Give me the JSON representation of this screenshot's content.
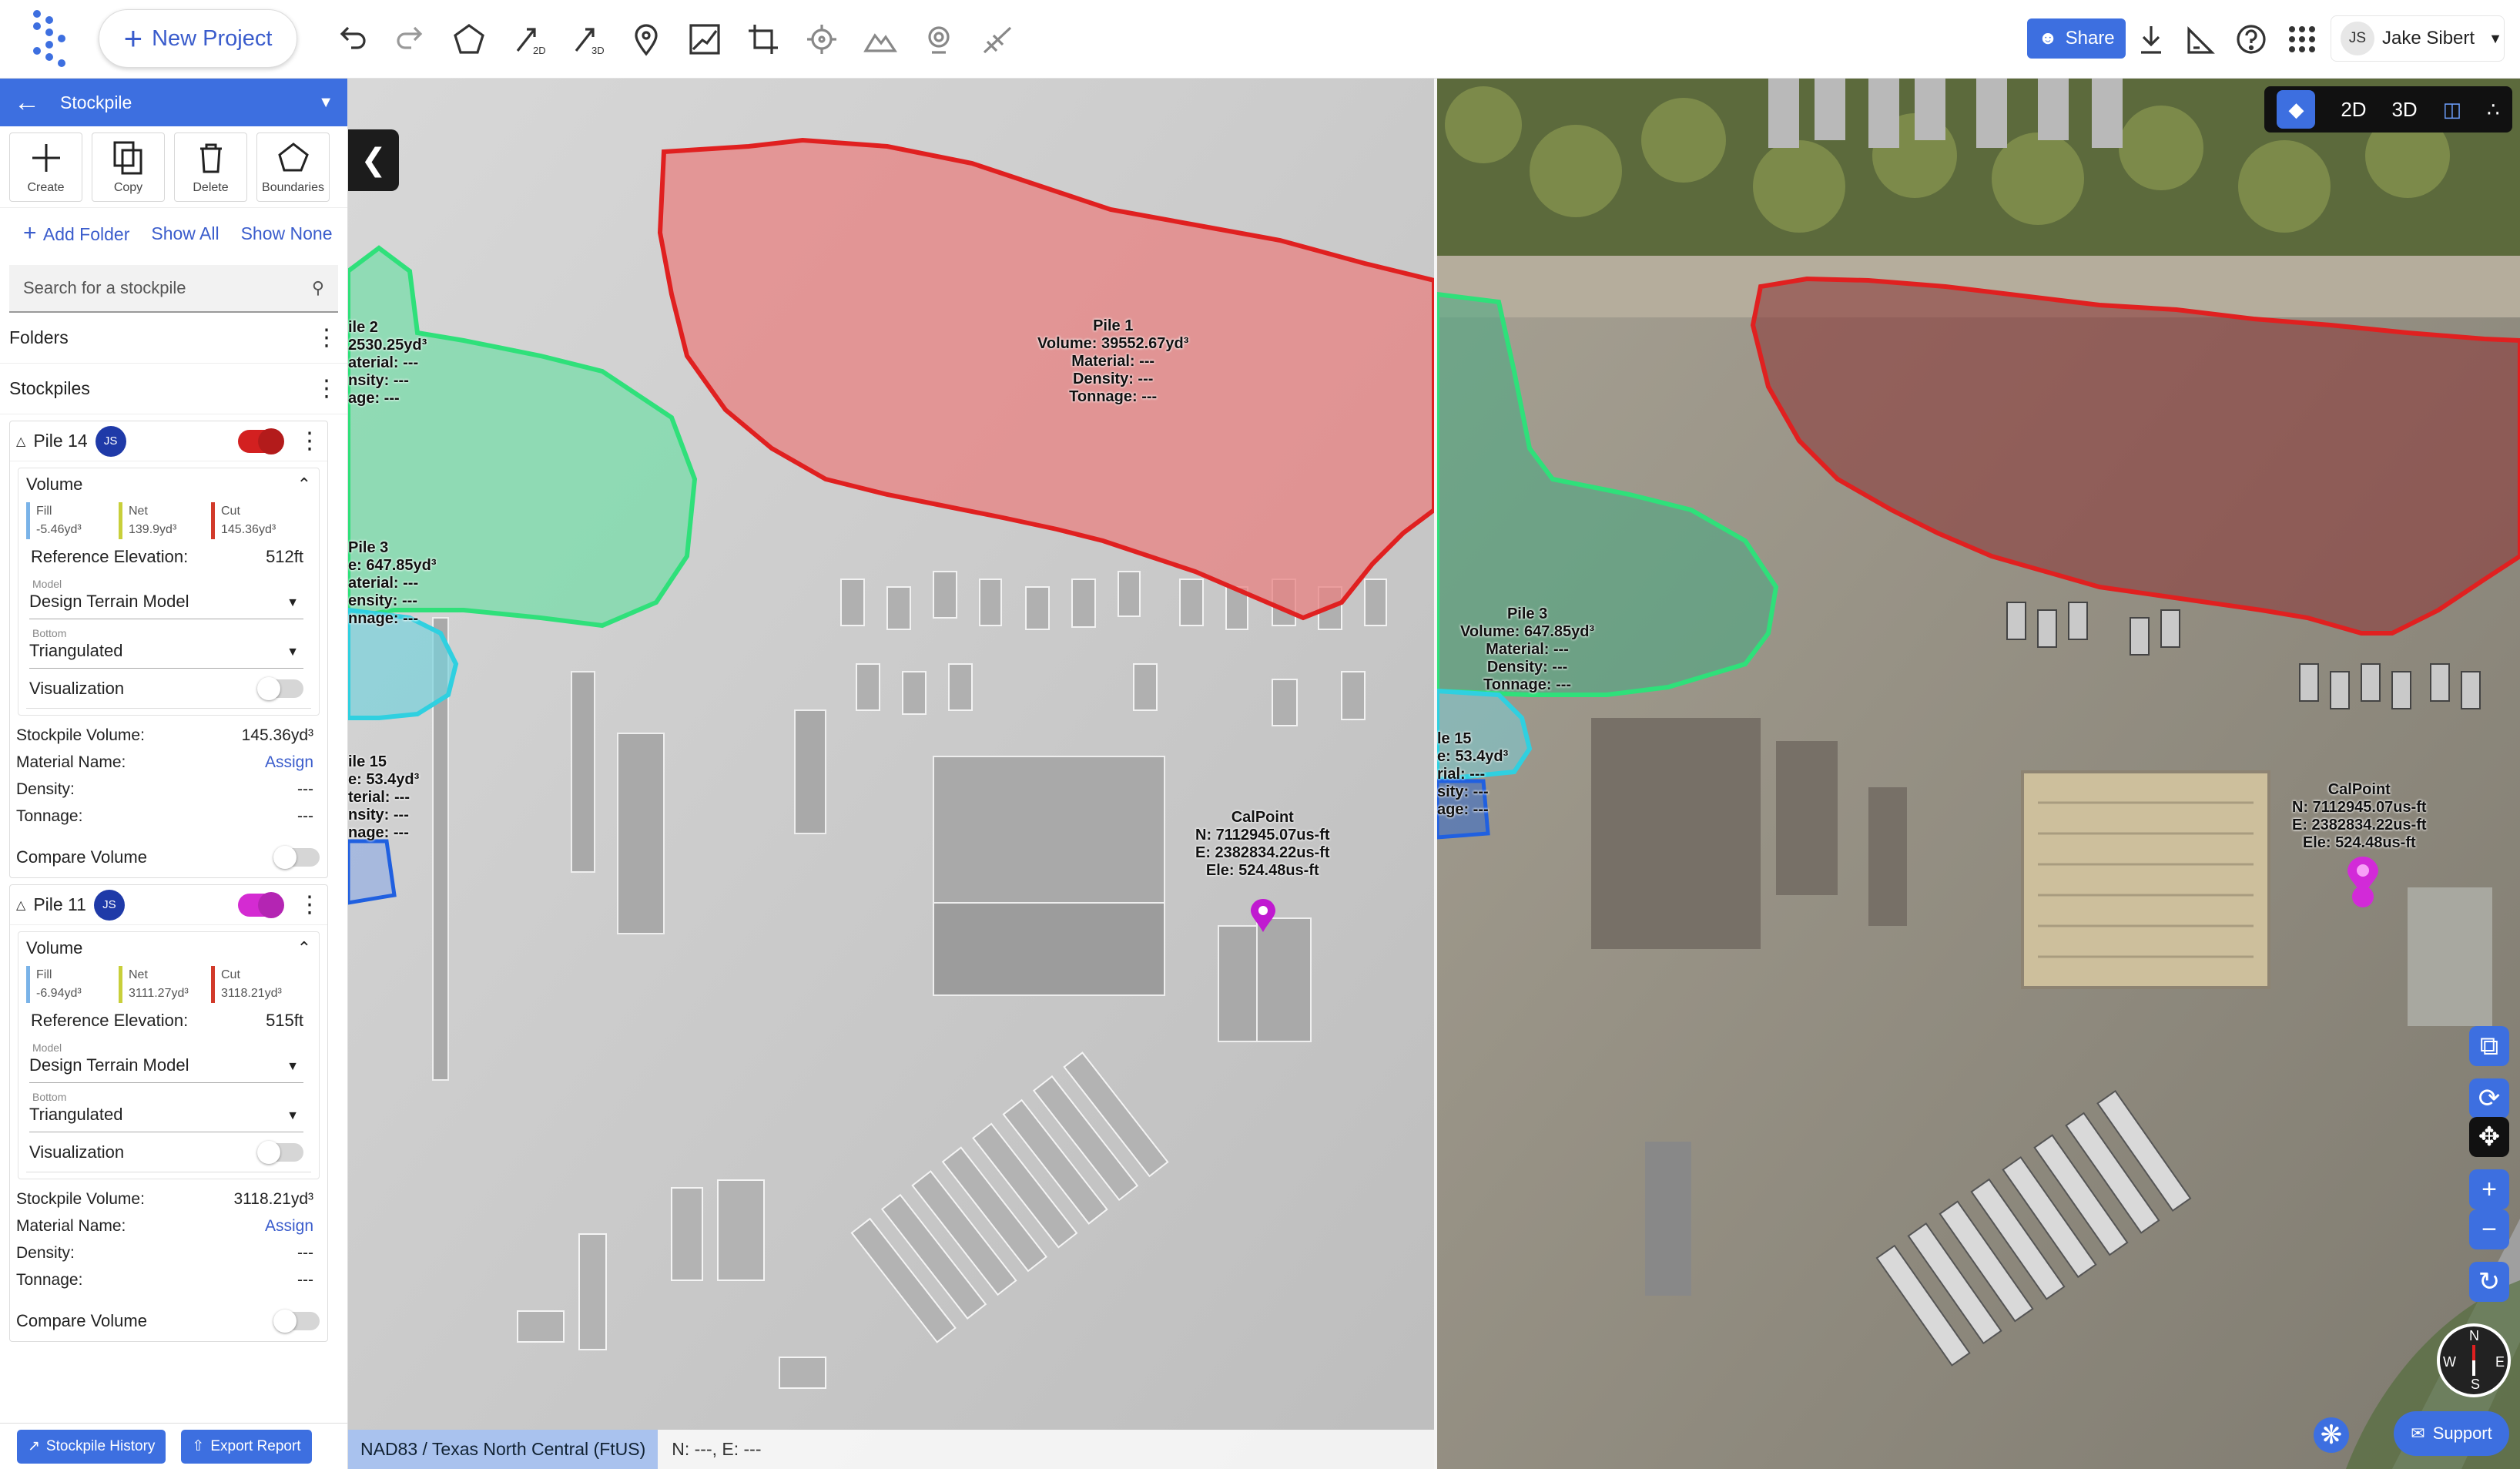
{
  "topbar": {
    "new_project": "New Project",
    "share": "Share",
    "user_initials": "JS",
    "user_name": "Jake Sibert"
  },
  "icons": {
    "undo": "undo-icon",
    "redo": "redo-icon",
    "polygon": "polygon-icon",
    "measure2d": "measure-2d-icon",
    "measure3d": "measure-3d-icon",
    "pin": "location-pin-icon",
    "profile": "elevation-profile-icon",
    "crop": "crop-icon",
    "target": "target-icon",
    "terrain": "terrain-icon",
    "gcp": "gcp-icon",
    "sweep": "sweep-icon",
    "download": "download-icon",
    "ruler": "ruler-icon",
    "help": "help-icon",
    "apps": "apps-grid-icon"
  },
  "panel": {
    "title": "Stockpile",
    "tools": [
      {
        "label": "Create"
      },
      {
        "label": "Copy"
      },
      {
        "label": "Delete"
      },
      {
        "label": "Boundaries"
      }
    ],
    "add_folder": "Add Folder",
    "show_all": "Show All",
    "show_none": "Show None",
    "search_placeholder": "Search for a stockpile",
    "folders": "Folders",
    "stockpiles": "Stockpiles"
  },
  "piles": [
    {
      "name": "Pile 14",
      "badge": "JS",
      "toggle_color": "#d32020",
      "volume": "Volume",
      "fill_label": "Fill",
      "fill": "-5.46yd³",
      "net_label": "Net",
      "net": "139.9yd³",
      "cut_label": "Cut",
      "cut": "145.36yd³",
      "ref_label": "Reference Elevation:",
      "ref": "512ft",
      "model_label": "Model",
      "model": "Design Terrain Model",
      "bottom_label": "Bottom",
      "bottom": "Triangulated",
      "visualization": "Visualization",
      "sv_label": "Stockpile Volume:",
      "sv": "145.36yd³",
      "mn_label": "Material Name:",
      "mn": "Assign",
      "density_label": "Density:",
      "density": "---",
      "tonnage_label": "Tonnage:",
      "tonnage": "---",
      "compare": "Compare Volume"
    },
    {
      "name": "Pile 11",
      "badge": "JS",
      "toggle_color": "#d42bd2",
      "volume": "Volume",
      "fill_label": "Fill",
      "fill": "-6.94yd³",
      "net_label": "Net",
      "net": "3111.27yd³",
      "cut_label": "Cut",
      "cut": "3118.21yd³",
      "ref_label": "Reference Elevation:",
      "ref": "515ft",
      "model_label": "Model",
      "model": "Design Terrain Model",
      "bottom_label": "Bottom",
      "bottom": "Triangulated",
      "visualization": "Visualization",
      "sv_label": "Stockpile Volume:",
      "sv": "3118.21yd³",
      "mn_label": "Material Name:",
      "mn": "Assign",
      "density_label": "Density:",
      "density": "---",
      "tonnage_label": "Tonnage:",
      "tonnage": "---",
      "compare": "Compare Volume"
    }
  ],
  "footer": {
    "history": "Stockpile History",
    "export": "Export Report"
  },
  "left_map": {
    "pile1": [
      "Pile 1",
      "Volume: 39552.67yd³",
      "Material: ---",
      "Density: ---",
      "Tonnage: ---"
    ],
    "pile2": [
      "ile 2",
      "2530.25yd³",
      "aterial: ---",
      "nsity: ---",
      "age: ---"
    ],
    "pile3": [
      "Pile 3",
      "e: 647.85yd³",
      "aterial: ---",
      "ensity: ---",
      "nnage: ---"
    ],
    "pile15": [
      "ile 15",
      "e: 53.4yd³",
      "terial: ---",
      "nsity: ---",
      "nage: ---"
    ],
    "calpoint": [
      "CalPoint",
      "N: 7112945.07us-ft",
      "E: 2382834.22us-ft",
      "Ele: 524.48us-ft"
    ]
  },
  "right_map": {
    "pile3": [
      "Pile 3",
      "Volume: 647.85yd³",
      "Material: ---",
      "Density: ---",
      "Tonnage: ---"
    ],
    "pile15": [
      "le 15",
      "e: 53.4yd³",
      "rial: ---",
      "sity: ---",
      "age: ---"
    ],
    "calpoint": [
      "CalPoint",
      "N: 7112945.07us-ft",
      "E: 2382834.22us-ft",
      "Ele: 524.48us-ft"
    ],
    "view_2d": "2D",
    "view_3d": "3D",
    "compass": [
      "N",
      "E",
      "S",
      "W"
    ]
  },
  "status": {
    "crs": "NAD83 / Texas North Central (FtUS)",
    "ne": "N: ---, E: ---"
  },
  "support": "Support",
  "colors": {
    "accent": "#3d6fe0",
    "pile_red": "#e02020",
    "pile_green": "#2fe07a",
    "pile_cyan": "#2fd0e0",
    "pile_blue": "#2060e0",
    "calpoint": "#c01ad0"
  }
}
